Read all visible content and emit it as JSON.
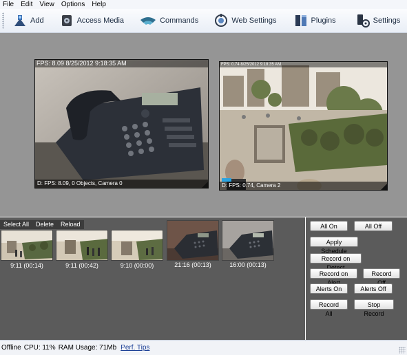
{
  "menu": [
    "File",
    "Edit",
    "View",
    "Options",
    "Help"
  ],
  "toolbar": {
    "add": "Add",
    "access_media": "Access Media",
    "commands": "Commands",
    "web_settings": "Web Settings",
    "plugins": "Plugins",
    "settings": "Settings"
  },
  "cameras": [
    {
      "top_text": "FPS: 8.09 8/25/2012 9:18:35 AM",
      "bottom_text": "D: FPS: 8.09, 0 Objects, Camera 0"
    },
    {
      "top_text": "FPS: 0.74 8/25/2012 9:18:35 AM",
      "bottom_text": "D: FPS: 0.74, Camera 2"
    }
  ],
  "thumb_toolbar": {
    "select_all": "Select All",
    "delete": "Delete",
    "reload": "Reload"
  },
  "thumbnails": [
    {
      "caption": "9:11 (00:14)",
      "scene": "street"
    },
    {
      "caption": "9:11 (00:42)",
      "scene": "street"
    },
    {
      "caption": "9:10 (00:00)",
      "scene": "street"
    },
    {
      "caption": "21:16 (00:13)",
      "scene": "phone"
    },
    {
      "caption": "16:00 (00:13)",
      "scene": "phone"
    }
  ],
  "controls": {
    "all_on": "All On",
    "all_off": "All Off",
    "apply_schedule": "Apply Schedule",
    "record_on_detect": "Record on Detect",
    "record_on_alert": "Record on Alert",
    "record_off": "Record Off",
    "alerts_on": "Alerts On",
    "alerts_off": "Alerts Off",
    "record_all": "Record All",
    "stop_record": "Stop Record"
  },
  "status": {
    "state": "Offline",
    "cpu": "CPU: 11%",
    "ram": "RAM Usage: 71Mb",
    "perf_tips": "Perf. Tips"
  },
  "icons": {
    "add": "add-camera-icon",
    "access_media": "media-icon",
    "commands": "commands-icon",
    "web_settings": "web-settings-icon",
    "plugins": "plugins-icon",
    "settings": "settings-icon"
  },
  "colors": {
    "stage_bg": "#959595",
    "panel_bg": "#5b5b5b",
    "level_bar": "#2aa3e0"
  }
}
